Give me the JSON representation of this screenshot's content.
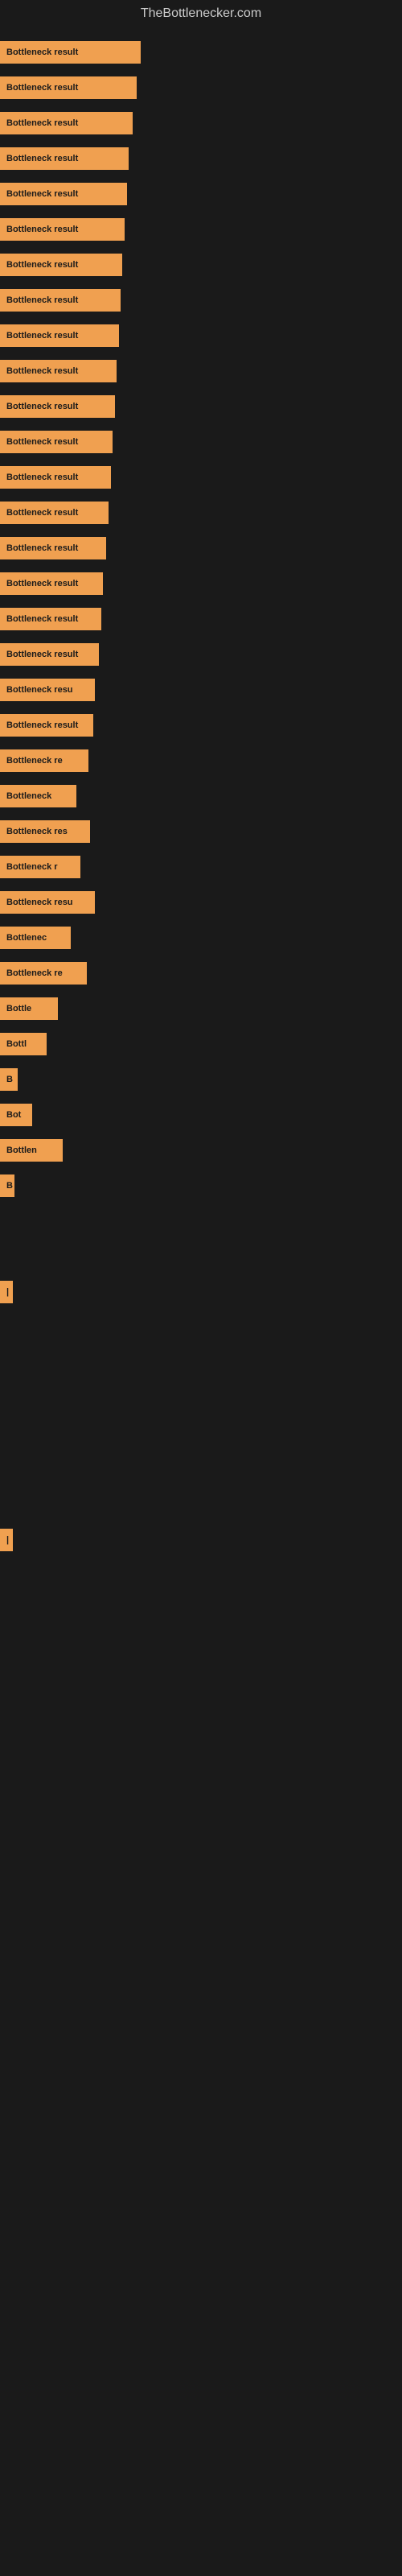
{
  "site": {
    "title": "TheBottlenecker.com"
  },
  "bars": [
    {
      "label": "Bottleneck result",
      "width": 175
    },
    {
      "label": "Bottleneck result",
      "width": 170
    },
    {
      "label": "Bottleneck result",
      "width": 165
    },
    {
      "label": "Bottleneck result",
      "width": 160
    },
    {
      "label": "Bottleneck result",
      "width": 158
    },
    {
      "label": "Bottleneck result",
      "width": 155
    },
    {
      "label": "Bottleneck result",
      "width": 152
    },
    {
      "label": "Bottleneck result",
      "width": 150
    },
    {
      "label": "Bottleneck result",
      "width": 148
    },
    {
      "label": "Bottleneck result",
      "width": 145
    },
    {
      "label": "Bottleneck result",
      "width": 143
    },
    {
      "label": "Bottleneck result",
      "width": 140
    },
    {
      "label": "Bottleneck result",
      "width": 138
    },
    {
      "label": "Bottleneck result",
      "width": 135
    },
    {
      "label": "Bottleneck result",
      "width": 132
    },
    {
      "label": "Bottleneck result",
      "width": 128
    },
    {
      "label": "Bottleneck result",
      "width": 126
    },
    {
      "label": "Bottleneck result",
      "width": 123
    },
    {
      "label": "Bottleneck resu",
      "width": 118
    },
    {
      "label": "Bottleneck result",
      "width": 116
    },
    {
      "label": "Bottleneck re",
      "width": 110
    },
    {
      "label": "Bottleneck",
      "width": 95
    },
    {
      "label": "Bottleneck res",
      "width": 112
    },
    {
      "label": "Bottleneck r",
      "width": 100
    },
    {
      "label": "Bottleneck resu",
      "width": 118
    },
    {
      "label": "Bottlenec",
      "width": 88
    },
    {
      "label": "Bottleneck re",
      "width": 108
    },
    {
      "label": "Bottle",
      "width": 72
    },
    {
      "label": "Bottl",
      "width": 58
    },
    {
      "label": "B",
      "width": 22
    },
    {
      "label": "Bot",
      "width": 40
    },
    {
      "label": "Bottlen",
      "width": 78
    },
    {
      "label": "B",
      "width": 18
    },
    {
      "label": "",
      "width": 0
    },
    {
      "label": "",
      "width": 0
    },
    {
      "label": "|",
      "width": 12
    },
    {
      "label": "",
      "width": 0
    },
    {
      "label": "",
      "width": 0
    },
    {
      "label": "",
      "width": 0
    },
    {
      "label": "",
      "width": 0
    },
    {
      "label": "",
      "width": 0
    },
    {
      "label": "",
      "width": 0
    },
    {
      "label": "|",
      "width": 8
    }
  ],
  "colors": {
    "bar_bg": "#f0a050",
    "bar_text": "#1a1a1a",
    "page_bg": "#1a1a1a",
    "title_text": "#cccccc"
  }
}
